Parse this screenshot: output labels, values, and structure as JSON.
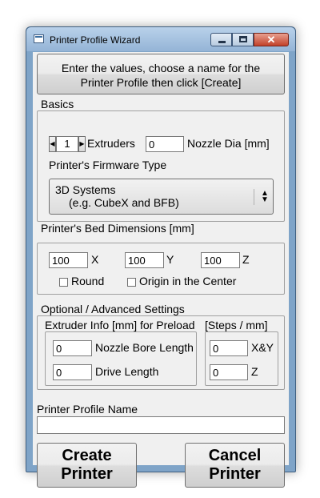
{
  "window": {
    "title": "Printer Profile Wizard",
    "close_glyph": "✕"
  },
  "instructions": {
    "line1": "Enter the values, choose a name for the",
    "line2": "Printer Profile then click [Create]"
  },
  "basics": {
    "legend": "Basics",
    "extruders_value": "1",
    "extruders_label": "Extruders",
    "nozzle_dia_value": "0",
    "nozzle_dia_label": "Nozzle Dia [mm]",
    "firmware_label": "Printer's Firmware Type",
    "firmware_selected_line1": "3D Systems",
    "firmware_selected_line2": "(e.g. CubeX and BFB)"
  },
  "bed": {
    "legend": "Printer's Bed Dimensions [mm]",
    "x_value": "100",
    "x_label": "X",
    "y_value": "100",
    "y_label": "Y",
    "z_value": "100",
    "z_label": "Z",
    "round_label": "Round",
    "origin_label": "Origin in the Center"
  },
  "advanced": {
    "legend": "Optional / Advanced Settings",
    "extruder_info_legend": "Extruder Info [mm] for Preload",
    "nozzle_bore_value": "0",
    "nozzle_bore_label": "Nozzle Bore Length",
    "drive_length_value": "0",
    "drive_length_label": "Drive Length",
    "steps_legend": "[Steps / mm]",
    "xy_value": "0",
    "xy_label": "X&Y",
    "z_value": "0",
    "z_label": "Z"
  },
  "profile": {
    "name_label": "Printer Profile Name",
    "name_value": ""
  },
  "actions": {
    "create_line1": "Create",
    "create_line2": "Printer",
    "cancel_line1": "Cancel",
    "cancel_line2": "Printer"
  }
}
